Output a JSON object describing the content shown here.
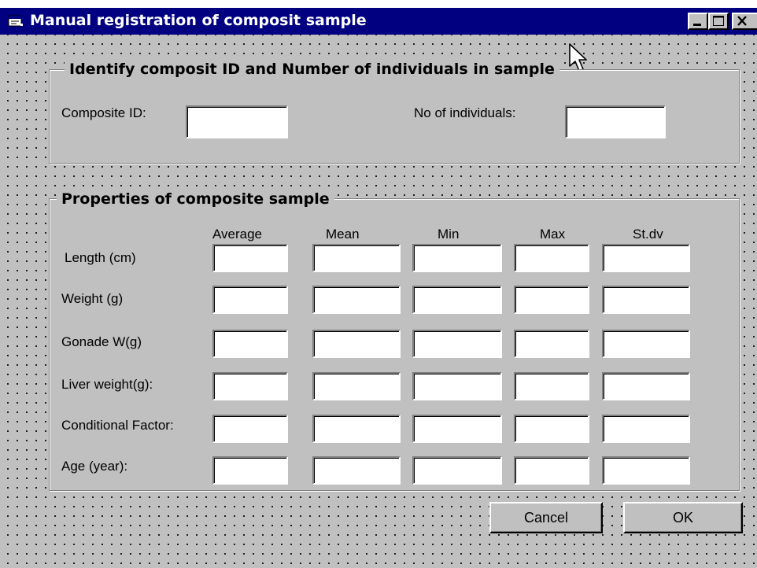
{
  "window": {
    "title": "Manual registration of composit sample",
    "title_bar_color": "#000080",
    "face_color": "#c0c0c0"
  },
  "title_buttons": [
    "minimize-icon",
    "maximize-icon",
    "close-icon"
  ],
  "identify_group": {
    "title": "Identify composit ID and Number of individuals in sample",
    "composite_id_label": "Composite ID:",
    "composite_id_value": "",
    "individuals_label": "No of individuals:",
    "individuals_value": ""
  },
  "properties_group": {
    "title": "Properties of composite sample",
    "columns": [
      "Average",
      "Mean",
      "Min",
      "Max",
      "St.dv"
    ],
    "rows": [
      {
        "label": "Length (cm)",
        "values": [
          "",
          "",
          "",
          "",
          ""
        ]
      },
      {
        "label": "Weight (g)",
        "values": [
          "",
          "",
          "",
          "",
          ""
        ]
      },
      {
        "label": "Gonade W(g)",
        "values": [
          "",
          "",
          "",
          "",
          ""
        ]
      },
      {
        "label": "Liver weight(g):",
        "values": [
          "",
          "",
          "",
          "",
          ""
        ]
      },
      {
        "label": "Conditional Factor:",
        "values": [
          "",
          "",
          "",
          "",
          ""
        ]
      },
      {
        "label": "Age (year):",
        "values": [
          "",
          "",
          "",
          "",
          ""
        ]
      }
    ]
  },
  "buttons": {
    "cancel": "Cancel",
    "ok": "OK"
  }
}
